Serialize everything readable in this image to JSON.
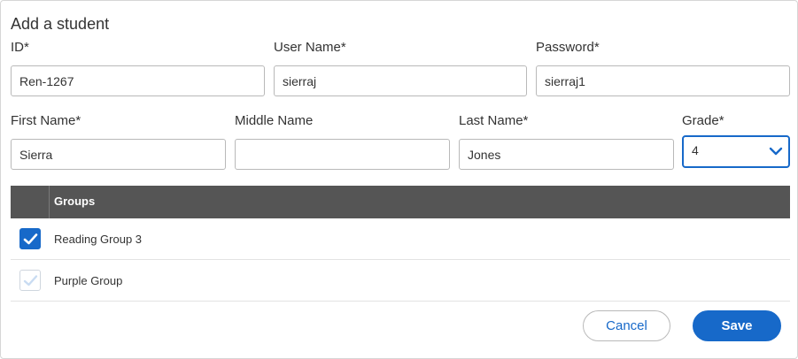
{
  "dialog": {
    "title": "Add a student"
  },
  "form": {
    "id": {
      "label": "ID*",
      "value": "Ren-1267"
    },
    "username": {
      "label": "User Name*",
      "value": "sierraj"
    },
    "password": {
      "label": "Password*",
      "value": "sierraj1"
    },
    "first_name": {
      "label": "First Name*",
      "value": "Sierra"
    },
    "middle_name": {
      "label": "Middle Name",
      "value": ""
    },
    "last_name": {
      "label": "Last Name*",
      "value": "Jones"
    },
    "grade": {
      "label": "Grade*",
      "value": "4"
    }
  },
  "groups": {
    "header": "Groups",
    "items": [
      {
        "label": "Reading Group 3",
        "checked": true
      },
      {
        "label": "Purple Group",
        "checked": false
      }
    ]
  },
  "actions": {
    "cancel_label": "Cancel",
    "save_label": "Save"
  },
  "colors": {
    "accent": "#1769c9",
    "header_bg": "#555555"
  },
  "icons": {
    "grade_dropdown": "chevron-down-icon",
    "checked": "checkmark-icon"
  }
}
